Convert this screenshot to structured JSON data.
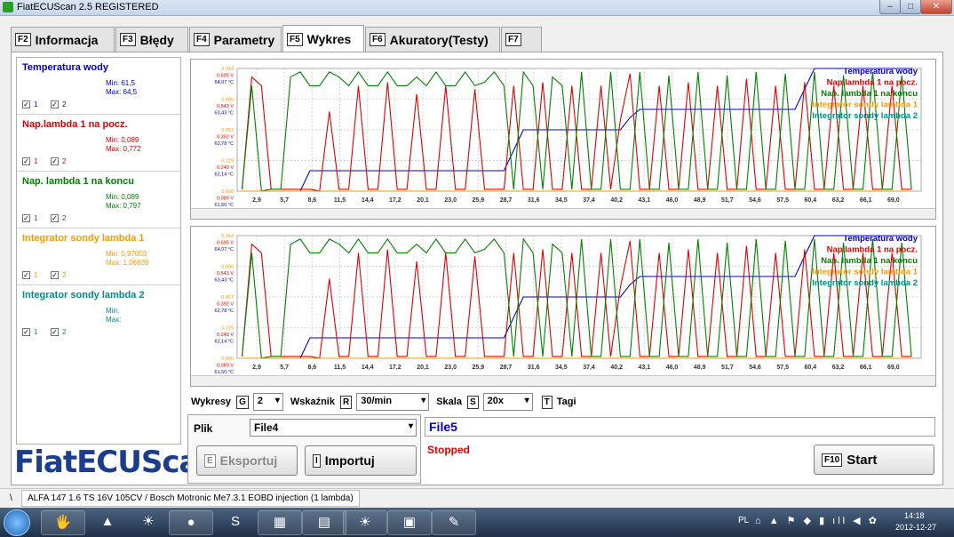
{
  "window": {
    "title": "FiatECUScan 2.5 REGISTERED",
    "min": "–",
    "max": "□",
    "close": "✕"
  },
  "tabs": [
    {
      "key": "F2",
      "label": "Informacja"
    },
    {
      "key": "F3",
      "label": "Błędy"
    },
    {
      "key": "F4",
      "label": "Parametry"
    },
    {
      "key": "F5",
      "label": "Wykres"
    },
    {
      "key": "F6",
      "label": "Akuratory(Testy)"
    },
    {
      "key": "F7",
      "label": ""
    }
  ],
  "legend": [
    {
      "name": "Temperatura wody",
      "color": "#0000c8",
      "min": "Min: 61,5",
      "max": "Max: 64,5"
    },
    {
      "name": "Nap.lambda 1 na pocz.",
      "color": "#e00000",
      "min": "Min: 0,089",
      "max": "Max: 0,772"
    },
    {
      "name": "Nap. lambda 1 na koncu",
      "color": "#008000",
      "min": "Min: 0,089",
      "max": "Max: 0,797"
    },
    {
      "name": "Integrator sondy lambda 1",
      "color": "#ff9900",
      "min": "Min: 0,97003",
      "max": "Max: 1,06839"
    },
    {
      "name": "Integrator sondy lambda 2",
      "color": "#008c8c",
      "min": "Min:",
      "max": "Max:"
    }
  ],
  "legend_cb": {
    "a": "1",
    "b": "2"
  },
  "logo": "FiatECUScan",
  "controls": {
    "wykresy_label": "Wykresy",
    "wykresy_key": "G",
    "wykresy_value": "2",
    "wskaznik_label": "Wskaźnik",
    "wskaznik_key": "R",
    "wskaznik_value": "30/min",
    "skala_label": "Skala",
    "skala_key": "S",
    "skala_value": "20x",
    "tagi_key": "T",
    "tagi_label": "Tagi"
  },
  "plik": {
    "label": "Plik",
    "value": "File4",
    "export_key": "E",
    "export_label": "Eksportuj",
    "import_key": "I",
    "import_label": "Importuj"
  },
  "file_panel": {
    "name": "File5",
    "status": "Stopped",
    "start_key": "F10",
    "start_label": "Start"
  },
  "statusbar": {
    "sep": "\\",
    "text": "ALFA 147 1.6 TS 16V 105CV / Bosch Motronic Me7.3.1 EOBD injection (1 lambda)"
  },
  "taskbar": {
    "lang": "PL",
    "time": "14:18",
    "date": "2012-12-27",
    "tray": "⌂ ▲ ⚑ ◆ ▮ ıll ◀ ✿"
  },
  "chart_data": [
    {
      "type": "line",
      "x_ticks": [
        "2,9",
        "5,7",
        "8,6",
        "11,5",
        "14,4",
        "17,2",
        "20,1",
        "23,0",
        "25,9",
        "28,7",
        "31,6",
        "34,5",
        "37,4",
        "40,2",
        "43,1",
        "46,0",
        "48,9",
        "51,7",
        "54,6",
        "57,5",
        "60,4",
        "63,2",
        "66,1",
        "69,0"
      ],
      "y_ticks": [
        {
          "label": "0,914",
          "color": "#ff9900"
        },
        {
          "label": "0,695 V",
          "color": "#e00000"
        },
        {
          "label": "64,07 °C",
          "color": "#0000c8"
        },
        {
          "label": "0,686",
          "color": "#ff9900"
        },
        {
          "label": "0,543 V",
          "color": "#e00000"
        },
        {
          "label": "63,43 °C",
          "color": "#0000c8"
        },
        {
          "label": "0,457",
          "color": "#ff9900"
        },
        {
          "label": "0,392 V",
          "color": "#e00000"
        },
        {
          "label": "62,78 °C",
          "color": "#0000c8"
        },
        {
          "label": "0,229",
          "color": "#ff9900"
        },
        {
          "label": "0,240 V",
          "color": "#e00000"
        },
        {
          "label": "62,14 °C",
          "color": "#0000c8"
        },
        {
          "label": "0,000",
          "color": "#ff9900"
        },
        {
          "label": "0,089 V",
          "color": "#e00000"
        },
        {
          "label": "61,50 °C",
          "color": "#0000c8"
        }
      ],
      "legend": [
        "Temperatura wody",
        "Nap.lambda 1 na pocz.",
        "Nap. lambda 1 na koncu",
        "Integrator sondy lambda 1",
        "Integrator sondy lambda 2"
      ],
      "series": [
        {
          "name": "Temperatura wody",
          "color": "#0000c8",
          "x": [
            1,
            4,
            6,
            7,
            8,
            28,
            29,
            30,
            33,
            40,
            41,
            42,
            58,
            59,
            60,
            61,
            70
          ],
          "y": [
            61.5,
            61.5,
            61.5,
            61.5,
            62.0,
            62.0,
            62.5,
            63.0,
            63.0,
            63.0,
            63.3,
            63.5,
            63.5,
            64.0,
            64.5,
            64.5,
            64.5
          ]
        },
        {
          "name": "Nap.lambda 1 na pocz.",
          "color": "#e00000",
          "x": [
            1,
            2,
            3,
            4,
            5,
            6,
            7,
            8,
            9,
            10,
            11,
            12,
            13,
            14,
            15,
            16,
            17,
            18,
            19,
            20,
            21,
            22,
            23,
            24,
            25,
            26,
            27,
            28,
            29,
            30,
            31,
            32,
            33,
            34,
            35,
            36,
            37,
            38,
            39,
            40,
            41,
            42,
            43,
            44,
            45,
            46,
            47,
            48,
            49,
            50,
            51,
            52,
            53,
            54,
            55,
            56,
            57,
            58,
            59,
            60,
            61,
            62,
            63,
            64,
            65,
            66,
            67,
            68,
            69,
            70
          ],
          "y": [
            0.1,
            0.75,
            0.7,
            0.1,
            0.1,
            0.1,
            0.1,
            0.1,
            0.09,
            0.55,
            0.1,
            0.1,
            0.7,
            0.1,
            0.1,
            0.72,
            0.1,
            0.1,
            0.65,
            0.1,
            0.1,
            0.7,
            0.1,
            0.1,
            0.68,
            0.1,
            0.1,
            0.1,
            0.7,
            0.1,
            0.1,
            0.72,
            0.1,
            0.1,
            0.7,
            0.1,
            0.1,
            0.7,
            0.1,
            0.5,
            0.77,
            0.1,
            0.1,
            0.7,
            0.1,
            0.1,
            0.72,
            0.1,
            0.1,
            0.7,
            0.1,
            0.1,
            0.74,
            0.1,
            0.1,
            0.7,
            0.1,
            0.1,
            0.72,
            0.1,
            0.1,
            0.7,
            0.1,
            0.1,
            0.7,
            0.1,
            0.1,
            0.7,
            0.1,
            0.1
          ]
        },
        {
          "name": "Nap. lambda 1 na koncu",
          "color": "#008000",
          "x": [
            1,
            2,
            3,
            4,
            5,
            6,
            7,
            8,
            9,
            10,
            11,
            12,
            13,
            14,
            15,
            16,
            17,
            18,
            19,
            20,
            21,
            22,
            23,
            24,
            25,
            26,
            27,
            28,
            29,
            30,
            31,
            32,
            33,
            34,
            35,
            36,
            37,
            38,
            39,
            40,
            41,
            42,
            43,
            44,
            45,
            46,
            47,
            48,
            49,
            50,
            51,
            52,
            53,
            54,
            55,
            56,
            57,
            58,
            59,
            60,
            61,
            62,
            63,
            64,
            65,
            66,
            67,
            68,
            69,
            70
          ],
          "y": [
            0.1,
            0.7,
            0.09,
            0.1,
            0.1,
            0.75,
            0.78,
            0.7,
            0.7,
            0.78,
            0.75,
            0.7,
            0.78,
            0.7,
            0.7,
            0.78,
            0.7,
            0.7,
            0.75,
            0.7,
            0.78,
            0.7,
            0.7,
            0.78,
            0.7,
            0.72,
            0.78,
            0.7,
            0.1,
            0.78,
            0.7,
            0.1,
            0.75,
            0.7,
            0.1,
            0.78,
            0.1,
            0.1,
            0.78,
            0.1,
            0.1,
            0.78,
            0.1,
            0.1,
            0.76,
            0.1,
            0.1,
            0.78,
            0.1,
            0.1,
            0.76,
            0.1,
            0.1,
            0.78,
            0.1,
            0.1,
            0.77,
            0.1,
            0.1,
            0.78,
            0.1,
            0.1,
            0.76,
            0.1,
            0.1,
            0.78,
            0.1,
            0.1,
            0.76,
            0.1
          ]
        },
        {
          "name": "Integrator sondy lambda 1",
          "color": "#ff9900",
          "x": [
            1,
            10,
            20,
            30,
            40,
            50,
            60,
            70
          ],
          "y": [
            0.05,
            0.05,
            0.05,
            0.06,
            0.05,
            0.05,
            0.06,
            0.05
          ]
        },
        {
          "name": "Integrator sondy lambda 2",
          "color": "#008c8c",
          "x": [],
          "y": []
        }
      ]
    },
    {
      "type": "line",
      "x_ticks": [
        "2,9",
        "5,7",
        "8,6",
        "11,5",
        "14,4",
        "17,2",
        "20,1",
        "23,0",
        "25,9",
        "28,7",
        "31,6",
        "34,5",
        "37,4",
        "40,2",
        "43,1",
        "46,0",
        "48,9",
        "51,7",
        "54,6",
        "57,5",
        "60,4",
        "63,2",
        "66,1",
        "69,0"
      ],
      "y_ticks": [
        {
          "label": "0,914",
          "color": "#ff9900"
        },
        {
          "label": "0,695 V",
          "color": "#e00000"
        },
        {
          "label": "64,07 °C",
          "color": "#0000c8"
        },
        {
          "label": "0,686",
          "color": "#ff9900"
        },
        {
          "label": "0,543 V",
          "color": "#e00000"
        },
        {
          "label": "63,43 °C",
          "color": "#0000c8"
        },
        {
          "label": "0,457",
          "color": "#ff9900"
        },
        {
          "label": "0,392 V",
          "color": "#e00000"
        },
        {
          "label": "62,78 °C",
          "color": "#0000c8"
        },
        {
          "label": "0,229",
          "color": "#ff9900"
        },
        {
          "label": "0,240 V",
          "color": "#e00000"
        },
        {
          "label": "62,14 °C",
          "color": "#0000c8"
        },
        {
          "label": "0,000",
          "color": "#ff9900"
        },
        {
          "label": "0,089 V",
          "color": "#e00000"
        },
        {
          "label": "61,50 °C",
          "color": "#0000c8"
        }
      ],
      "legend": [
        "Temperatura wody",
        "Nap.lambda 1 na pocz.",
        "Nap. lambda 1 na koncu",
        "Integrator sondy lambda 1",
        "Integrator sondy lambda 2"
      ],
      "series": [
        {
          "name": "Temperatura wody",
          "color": "#0000c8",
          "x": [
            1,
            6,
            7,
            8,
            28,
            29,
            30,
            33,
            40,
            41,
            42,
            58,
            59,
            60,
            61,
            70
          ],
          "y": [
            61.5,
            61.5,
            61.5,
            62.0,
            62.0,
            62.5,
            63.0,
            63.0,
            63.0,
            63.3,
            63.5,
            63.5,
            64.0,
            64.5,
            64.5,
            64.5
          ]
        },
        {
          "name": "Nap.lambda 1 na pocz.",
          "color": "#e00000",
          "x": [
            1,
            2,
            3,
            4,
            5,
            6,
            7,
            8,
            9,
            10,
            11,
            12,
            13,
            14,
            15,
            16,
            17,
            18,
            19,
            20,
            21,
            22,
            23,
            24,
            25,
            26,
            27,
            28,
            29,
            30,
            31,
            32,
            33,
            34,
            35,
            36,
            37,
            38,
            39,
            40,
            41,
            42,
            43,
            44,
            45,
            46,
            47,
            48,
            49,
            50,
            51,
            52,
            53,
            54,
            55,
            56,
            57,
            58,
            59,
            60,
            61,
            62,
            63,
            64,
            65,
            66,
            67,
            68,
            69,
            70
          ],
          "y": [
            0.1,
            0.75,
            0.7,
            0.1,
            0.1,
            0.1,
            0.1,
            0.1,
            0.09,
            0.55,
            0.1,
            0.1,
            0.7,
            0.1,
            0.1,
            0.72,
            0.1,
            0.1,
            0.65,
            0.1,
            0.1,
            0.7,
            0.1,
            0.1,
            0.68,
            0.1,
            0.1,
            0.1,
            0.7,
            0.1,
            0.1,
            0.72,
            0.1,
            0.1,
            0.7,
            0.1,
            0.1,
            0.7,
            0.1,
            0.5,
            0.77,
            0.1,
            0.1,
            0.7,
            0.1,
            0.1,
            0.72,
            0.1,
            0.1,
            0.7,
            0.1,
            0.1,
            0.74,
            0.1,
            0.1,
            0.7,
            0.1,
            0.1,
            0.72,
            0.1,
            0.1,
            0.7,
            0.1,
            0.1,
            0.7,
            0.1,
            0.1,
            0.7,
            0.1,
            0.1
          ]
        },
        {
          "name": "Nap. lambda 1 na koncu",
          "color": "#008000",
          "x": [
            1,
            2,
            3,
            4,
            5,
            6,
            7,
            8,
            9,
            10,
            11,
            12,
            13,
            14,
            15,
            16,
            17,
            18,
            19,
            20,
            21,
            22,
            23,
            24,
            25,
            26,
            27,
            28,
            29,
            30,
            31,
            32,
            33,
            34,
            35,
            36,
            37,
            38,
            39,
            40,
            41,
            42,
            43,
            44,
            45,
            46,
            47,
            48,
            49,
            50,
            51,
            52,
            53,
            54,
            55,
            56,
            57,
            58,
            59,
            60,
            61,
            62,
            63,
            64,
            65,
            66,
            67,
            68,
            69,
            70
          ],
          "y": [
            0.1,
            0.7,
            0.09,
            0.1,
            0.1,
            0.75,
            0.78,
            0.7,
            0.7,
            0.78,
            0.75,
            0.7,
            0.78,
            0.7,
            0.7,
            0.78,
            0.7,
            0.7,
            0.75,
            0.7,
            0.78,
            0.7,
            0.7,
            0.78,
            0.7,
            0.72,
            0.78,
            0.7,
            0.1,
            0.78,
            0.7,
            0.1,
            0.75,
            0.7,
            0.1,
            0.78,
            0.1,
            0.1,
            0.78,
            0.1,
            0.1,
            0.78,
            0.1,
            0.1,
            0.76,
            0.1,
            0.1,
            0.78,
            0.1,
            0.1,
            0.76,
            0.1,
            0.1,
            0.78,
            0.1,
            0.1,
            0.77,
            0.1,
            0.1,
            0.78,
            0.1,
            0.1,
            0.76,
            0.1,
            0.1,
            0.78,
            0.1,
            0.1,
            0.76,
            0.1
          ]
        },
        {
          "name": "Integrator sondy lambda 1",
          "color": "#ff9900",
          "x": [
            1,
            10,
            20,
            30,
            40,
            50,
            60,
            70
          ],
          "y": [
            0.05,
            0.05,
            0.05,
            0.06,
            0.05,
            0.05,
            0.06,
            0.05
          ]
        },
        {
          "name": "Integrator sondy lambda 2",
          "color": "#008c8c",
          "x": [],
          "y": []
        }
      ]
    }
  ]
}
